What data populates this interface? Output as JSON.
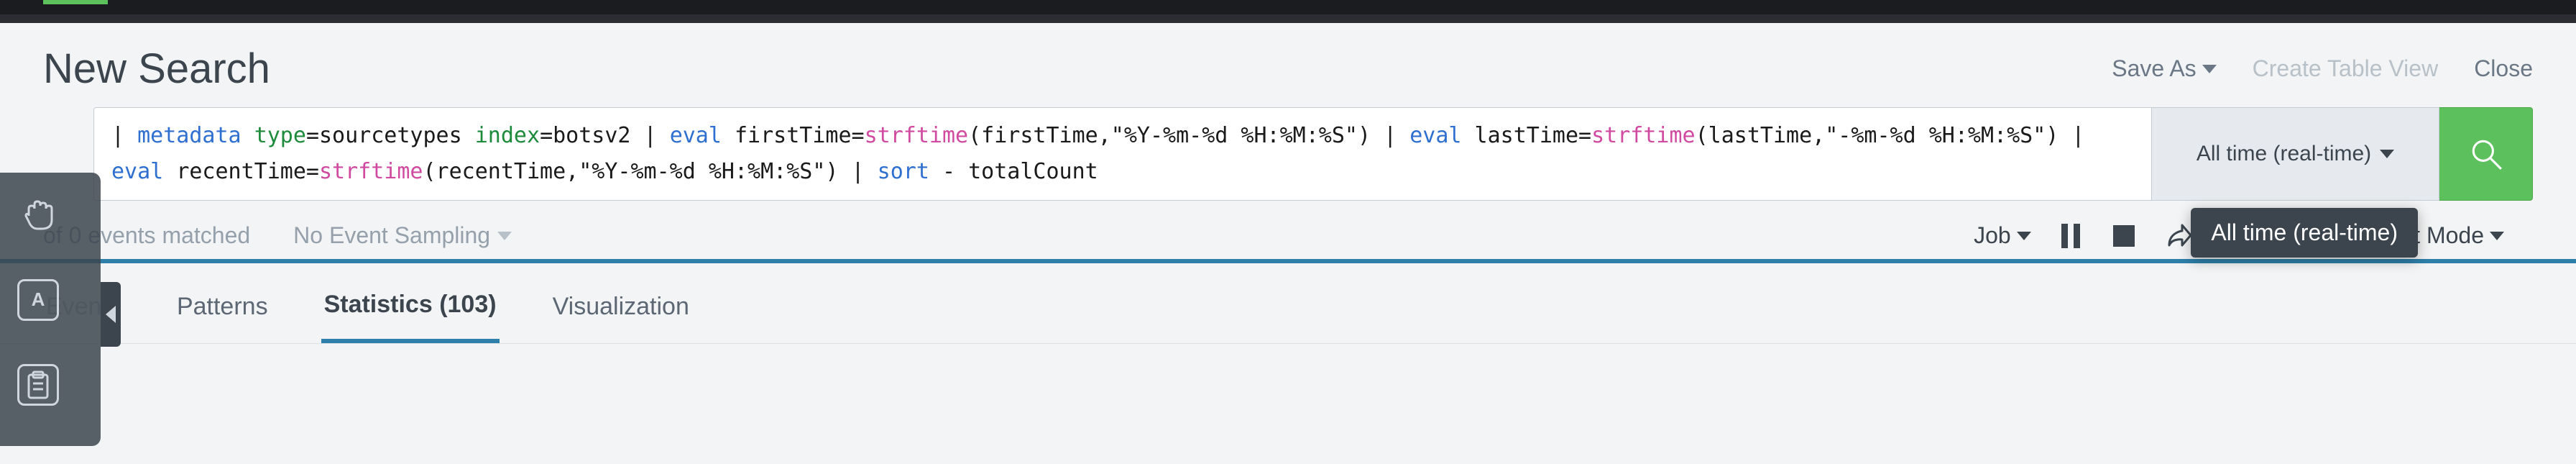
{
  "header": {
    "title": "New Search",
    "save_as": "Save As",
    "create_table": "Create Table View",
    "close": "Close"
  },
  "search": {
    "tokens": [
      {
        "cls": "t-pipe",
        "txt": "| "
      },
      {
        "cls": "t-cmd",
        "txt": "metadata "
      },
      {
        "cls": "t-arg",
        "txt": "type"
      },
      {
        "cls": "t-text",
        "txt": "=sourcetypes "
      },
      {
        "cls": "t-arg",
        "txt": "index"
      },
      {
        "cls": "t-text",
        "txt": "=botsv2 "
      },
      {
        "cls": "t-pipe",
        "txt": "| "
      },
      {
        "cls": "t-cmd",
        "txt": "eval "
      },
      {
        "cls": "t-text",
        "txt": "firstTime="
      },
      {
        "cls": "t-func",
        "txt": "strftime"
      },
      {
        "cls": "t-text",
        "txt": "(firstTime,\"%Y-%m-%d %H:%M:%S\") "
      },
      {
        "cls": "t-pipe",
        "txt": "| "
      },
      {
        "cls": "t-cmd",
        "txt": "eval "
      },
      {
        "cls": "t-text",
        "txt": "lastTime="
      },
      {
        "cls": "t-func",
        "txt": "strftime"
      },
      {
        "cls": "t-text",
        "txt": "(lastTime,\"-%m-%d %H:%M:%S\") "
      },
      {
        "cls": "t-pipe",
        "txt": "| "
      },
      {
        "cls": "t-cmd",
        "txt": "eval "
      },
      {
        "cls": "t-text",
        "txt": "recentTime="
      },
      {
        "cls": "t-func",
        "txt": "strftime"
      },
      {
        "cls": "t-text",
        "txt": "(recentTime,\"%Y-%m-%d %H:%M:%S\") "
      },
      {
        "cls": "t-pipe",
        "txt": "| "
      },
      {
        "cls": "t-cmd",
        "txt": "sort "
      },
      {
        "cls": "t-text",
        "txt": "- totalCount"
      }
    ],
    "time_label": "All time (real-time)",
    "tooltip": "All time (real-time)"
  },
  "jobbar": {
    "matched": "of 0 events matched",
    "sampling": "No Event Sampling",
    "job": "Job",
    "smart": "Smart Mode"
  },
  "tabs": {
    "events": "Events",
    "patterns": "Patterns",
    "stats": "Statistics (103)",
    "viz": "Visualization"
  },
  "icons": {
    "hand": "hand-icon",
    "a": "text-select-icon",
    "clipboard": "clipboard-icon",
    "pause": "pause-icon",
    "stop": "stop-icon",
    "share": "share-icon",
    "print": "print-icon",
    "download": "download-icon",
    "search": "search-icon",
    "caret": "caret-down-icon"
  }
}
